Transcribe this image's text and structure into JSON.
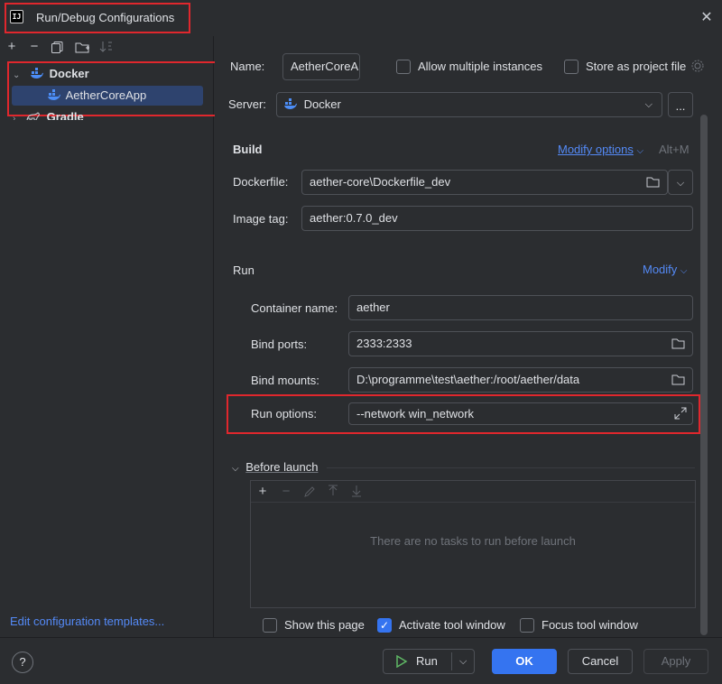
{
  "window": {
    "title": "Run/Debug Configurations",
    "icon_text": "IJ"
  },
  "left_toolbar": {
    "icons": [
      "add-icon",
      "remove-icon",
      "copy-icon",
      "new-folder-icon",
      "sort-icon"
    ]
  },
  "tree": {
    "items": [
      {
        "label": "Docker",
        "level": 0,
        "expanded": true,
        "icon": "docker-icon"
      },
      {
        "label": "AetherCoreApp",
        "level": 1,
        "selected": true,
        "icon": "docker-icon"
      },
      {
        "label": "Gradle",
        "level": 0,
        "expanded": false,
        "icon": "gradle-icon"
      }
    ]
  },
  "edit_templates_link": "Edit configuration templates...",
  "form": {
    "name_label": "Name:",
    "name_value": "AetherCoreA",
    "allow_multiple_label": "Allow multiple instances",
    "store_as_project_label": "Store as project file",
    "server_label": "Server:",
    "server_value": "Docker",
    "server_more": "...",
    "build": {
      "title": "Build",
      "modify_options": "Modify options",
      "shortcut": "Alt+M",
      "dockerfile_label": "Dockerfile:",
      "dockerfile_value": "aether-core\\Dockerfile_dev",
      "image_tag_label": "Image tag:",
      "image_tag_value": "aether:0.7.0_dev"
    },
    "run": {
      "title": "Run",
      "modify": "Modify",
      "container_name_label": "Container name:",
      "container_name_value": "aether",
      "bind_ports_label": "Bind ports:",
      "bind_ports_value": "2333:2333",
      "bind_mounts_label": "Bind mounts:",
      "bind_mounts_value": "D:\\programme\\test\\aether:/root/aether/data",
      "run_options_label": "Run options:",
      "run_options_value": "--network win_network"
    },
    "before_launch": {
      "title": "Before launch",
      "empty_text": "There are no tasks to run before launch"
    },
    "show_this_page": "Show this page",
    "activate_tool_window": "Activate tool window",
    "focus_tool_window": "Focus tool window"
  },
  "footer": {
    "help": "?",
    "run": "Run",
    "ok": "OK",
    "cancel": "Cancel",
    "apply": "Apply"
  },
  "colors": {
    "accent": "#3574f0",
    "link": "#548af7",
    "highlight_box": "#e0272d",
    "selection": "#2e436e",
    "run_icon": "#5fb865"
  }
}
